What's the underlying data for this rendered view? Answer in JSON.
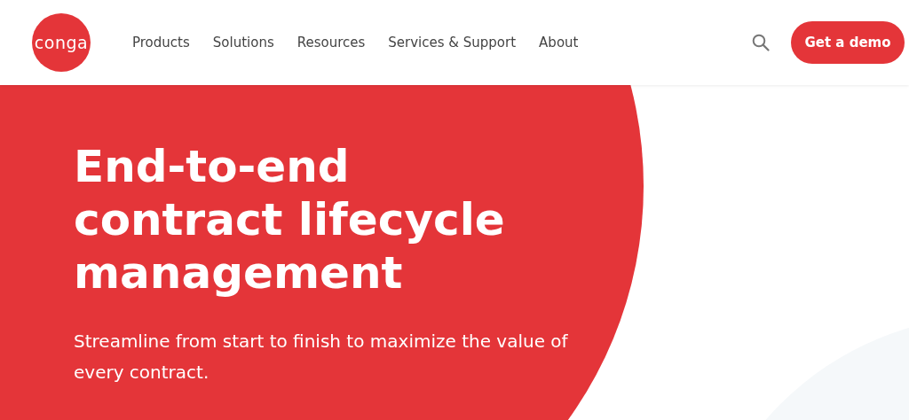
{
  "header": {
    "logo": "conga",
    "nav": [
      {
        "label": "Products"
      },
      {
        "label": "Solutions"
      },
      {
        "label": "Resources"
      },
      {
        "label": "Services & Support"
      },
      {
        "label": "About"
      }
    ],
    "cta": "Get a demo"
  },
  "hero": {
    "title_lines": [
      "End-to-end",
      "contract lifecycle",
      "management"
    ],
    "subtitle": "Streamline from start to finish to maximize the value of every contract."
  }
}
